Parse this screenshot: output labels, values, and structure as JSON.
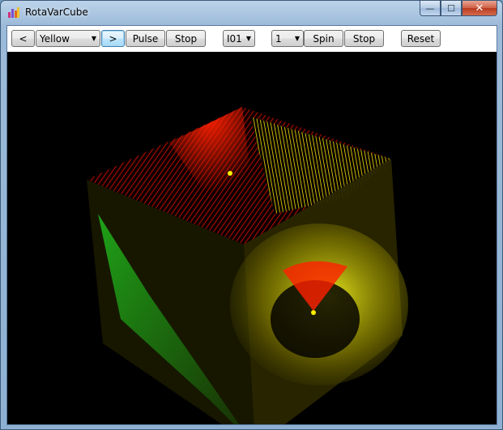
{
  "window": {
    "title": "RotaVarCube",
    "caption": {
      "minimize": "—",
      "maximize": "☐",
      "close": "✕"
    }
  },
  "toolbar": {
    "prev_label": "<",
    "color_select": "Yellow",
    "next_label": ">",
    "pulse_label": "Pulse",
    "stop_pulse_label": "Stop",
    "mode_select": "I01",
    "speed_select": "1",
    "spin_label": "Spin",
    "stop_spin_label": "Stop",
    "reset_label": "Reset"
  },
  "scene": {
    "background": "#000000",
    "colors": {
      "red": "#ff1a00",
      "yellow": "#f0f000",
      "green": "#22dd22",
      "olive": "#3a3400"
    }
  }
}
